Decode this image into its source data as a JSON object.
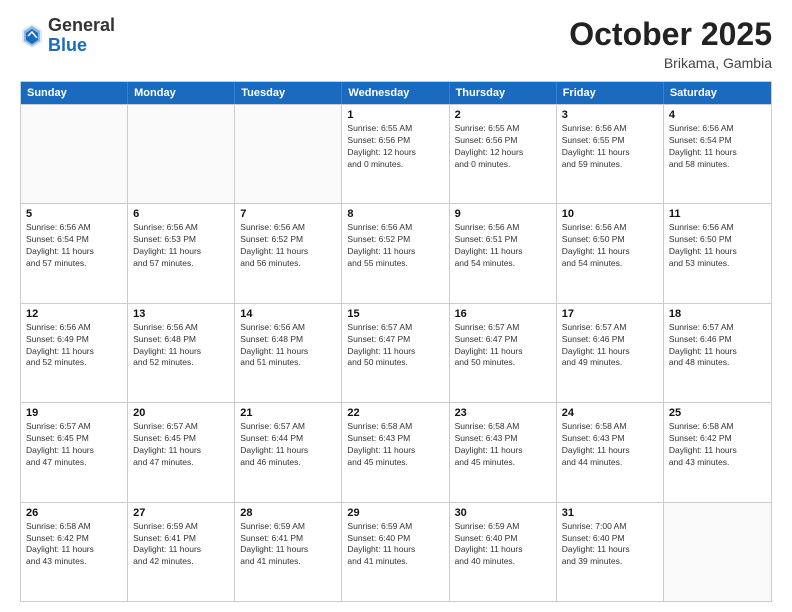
{
  "header": {
    "logo": {
      "general": "General",
      "blue": "Blue"
    },
    "title": "October 2025",
    "location": "Brikama, Gambia"
  },
  "calendar": {
    "weekdays": [
      "Sunday",
      "Monday",
      "Tuesday",
      "Wednesday",
      "Thursday",
      "Friday",
      "Saturday"
    ],
    "weeks": [
      [
        {
          "day": null,
          "info": null
        },
        {
          "day": null,
          "info": null
        },
        {
          "day": null,
          "info": null
        },
        {
          "day": "1",
          "info": "Sunrise: 6:55 AM\nSunset: 6:56 PM\nDaylight: 12 hours\nand 0 minutes."
        },
        {
          "day": "2",
          "info": "Sunrise: 6:55 AM\nSunset: 6:56 PM\nDaylight: 12 hours\nand 0 minutes."
        },
        {
          "day": "3",
          "info": "Sunrise: 6:56 AM\nSunset: 6:55 PM\nDaylight: 11 hours\nand 59 minutes."
        },
        {
          "day": "4",
          "info": "Sunrise: 6:56 AM\nSunset: 6:54 PM\nDaylight: 11 hours\nand 58 minutes."
        }
      ],
      [
        {
          "day": "5",
          "info": "Sunrise: 6:56 AM\nSunset: 6:54 PM\nDaylight: 11 hours\nand 57 minutes."
        },
        {
          "day": "6",
          "info": "Sunrise: 6:56 AM\nSunset: 6:53 PM\nDaylight: 11 hours\nand 57 minutes."
        },
        {
          "day": "7",
          "info": "Sunrise: 6:56 AM\nSunset: 6:52 PM\nDaylight: 11 hours\nand 56 minutes."
        },
        {
          "day": "8",
          "info": "Sunrise: 6:56 AM\nSunset: 6:52 PM\nDaylight: 11 hours\nand 55 minutes."
        },
        {
          "day": "9",
          "info": "Sunrise: 6:56 AM\nSunset: 6:51 PM\nDaylight: 11 hours\nand 54 minutes."
        },
        {
          "day": "10",
          "info": "Sunrise: 6:56 AM\nSunset: 6:50 PM\nDaylight: 11 hours\nand 54 minutes."
        },
        {
          "day": "11",
          "info": "Sunrise: 6:56 AM\nSunset: 6:50 PM\nDaylight: 11 hours\nand 53 minutes."
        }
      ],
      [
        {
          "day": "12",
          "info": "Sunrise: 6:56 AM\nSunset: 6:49 PM\nDaylight: 11 hours\nand 52 minutes."
        },
        {
          "day": "13",
          "info": "Sunrise: 6:56 AM\nSunset: 6:48 PM\nDaylight: 11 hours\nand 52 minutes."
        },
        {
          "day": "14",
          "info": "Sunrise: 6:56 AM\nSunset: 6:48 PM\nDaylight: 11 hours\nand 51 minutes."
        },
        {
          "day": "15",
          "info": "Sunrise: 6:57 AM\nSunset: 6:47 PM\nDaylight: 11 hours\nand 50 minutes."
        },
        {
          "day": "16",
          "info": "Sunrise: 6:57 AM\nSunset: 6:47 PM\nDaylight: 11 hours\nand 50 minutes."
        },
        {
          "day": "17",
          "info": "Sunrise: 6:57 AM\nSunset: 6:46 PM\nDaylight: 11 hours\nand 49 minutes."
        },
        {
          "day": "18",
          "info": "Sunrise: 6:57 AM\nSunset: 6:46 PM\nDaylight: 11 hours\nand 48 minutes."
        }
      ],
      [
        {
          "day": "19",
          "info": "Sunrise: 6:57 AM\nSunset: 6:45 PM\nDaylight: 11 hours\nand 47 minutes."
        },
        {
          "day": "20",
          "info": "Sunrise: 6:57 AM\nSunset: 6:45 PM\nDaylight: 11 hours\nand 47 minutes."
        },
        {
          "day": "21",
          "info": "Sunrise: 6:57 AM\nSunset: 6:44 PM\nDaylight: 11 hours\nand 46 minutes."
        },
        {
          "day": "22",
          "info": "Sunrise: 6:58 AM\nSunset: 6:43 PM\nDaylight: 11 hours\nand 45 minutes."
        },
        {
          "day": "23",
          "info": "Sunrise: 6:58 AM\nSunset: 6:43 PM\nDaylight: 11 hours\nand 45 minutes."
        },
        {
          "day": "24",
          "info": "Sunrise: 6:58 AM\nSunset: 6:43 PM\nDaylight: 11 hours\nand 44 minutes."
        },
        {
          "day": "25",
          "info": "Sunrise: 6:58 AM\nSunset: 6:42 PM\nDaylight: 11 hours\nand 43 minutes."
        }
      ],
      [
        {
          "day": "26",
          "info": "Sunrise: 6:58 AM\nSunset: 6:42 PM\nDaylight: 11 hours\nand 43 minutes."
        },
        {
          "day": "27",
          "info": "Sunrise: 6:59 AM\nSunset: 6:41 PM\nDaylight: 11 hours\nand 42 minutes."
        },
        {
          "day": "28",
          "info": "Sunrise: 6:59 AM\nSunset: 6:41 PM\nDaylight: 11 hours\nand 41 minutes."
        },
        {
          "day": "29",
          "info": "Sunrise: 6:59 AM\nSunset: 6:40 PM\nDaylight: 11 hours\nand 41 minutes."
        },
        {
          "day": "30",
          "info": "Sunrise: 6:59 AM\nSunset: 6:40 PM\nDaylight: 11 hours\nand 40 minutes."
        },
        {
          "day": "31",
          "info": "Sunrise: 7:00 AM\nSunset: 6:40 PM\nDaylight: 11 hours\nand 39 minutes."
        },
        {
          "day": null,
          "info": null
        }
      ]
    ]
  }
}
